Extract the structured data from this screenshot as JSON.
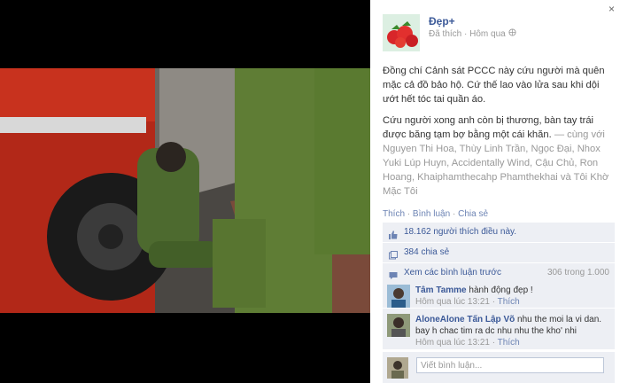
{
  "post": {
    "page_name": "Đẹp+",
    "liked": "Đã thích",
    "time": "Hôm qua",
    "caption_p1": "Đồng chí Cảnh sát PCCC này cứu người mà quên mặc cả đồ bảo hộ. Cứ thế lao vào lửa sau khi dội ướt hết tóc tai quần áo.",
    "caption_p2": "Cứu người xong anh còn bị thương, bàn tay trái được băng tạm bợ bằng một cái khăn.",
    "caption_tags": "— cùng với Nguyen Thi Hoa, Thùy Linh Trần, Ngọc Đại, Nhox Yuki Lúp Huyn, Accidentally Wind, Cậu Chủ, Ron Hoang, Khaiphamthecahp Phamthekhai và Tôi Khờ Mặc Tôi"
  },
  "actions": {
    "like": "Thích",
    "comment": "Bình luận",
    "share": "Chia sẻ",
    "sep": "·"
  },
  "stats": {
    "likes": "18.162 người thích điều này.",
    "shares": "384 chia sẻ",
    "view_previous": "Xem các bình luận trước",
    "count": "306 trong 1.000"
  },
  "comments": [
    {
      "author": "Tâm Tamme",
      "text": " hành động đẹp !",
      "time": "Hôm qua lúc 13:21",
      "like": "Thích"
    },
    {
      "author": "AloneAlone Tấn Lập Võ",
      "text": " nhu the moi la vi dan. bay h chac tim ra dc nhu nhu the kho' nhi",
      "time": "Hôm qua lúc 13:21",
      "like": "Thích"
    }
  ],
  "input_placeholder": "Viết bình luận...",
  "close": "×",
  "colors": {
    "link": "#3b5998",
    "panel": "#edeff4"
  }
}
